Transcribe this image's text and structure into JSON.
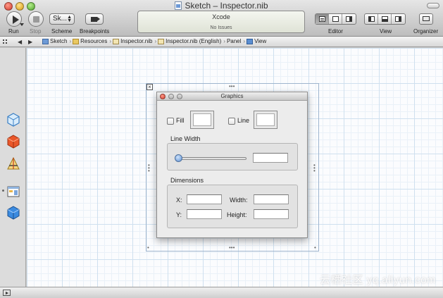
{
  "window": {
    "title": "Sketch – Inspector.nib"
  },
  "toolbar": {
    "run_label": "Run",
    "stop_label": "Stop",
    "scheme_label": "Scheme",
    "scheme_value": "Sk...",
    "breakpoints_label": "Breakpoints",
    "editor_label": "Editor",
    "view_label": "View",
    "organizer_label": "Organizer"
  },
  "activity": {
    "app_name": "Xcode",
    "status": "No Issues"
  },
  "jumpbar": {
    "crumbs": [
      "Sketch",
      "Resources",
      "Inspector.nib",
      "Inspector.nib (English)",
      "Panel",
      "View"
    ]
  },
  "panel": {
    "title": "Graphics",
    "fill_label": "Fill",
    "line_label": "Line",
    "line_width_title": "Line Width",
    "line_width_value": 0.0,
    "dimensions_title": "Dimensions",
    "x_label": "X:",
    "y_label": "Y:",
    "width_label": "Width:",
    "height_label": "Height:",
    "x_value": "",
    "y_value": "",
    "width_value": "",
    "height_value": ""
  },
  "watermark": "云栖社区 yq.aliyun.com"
}
